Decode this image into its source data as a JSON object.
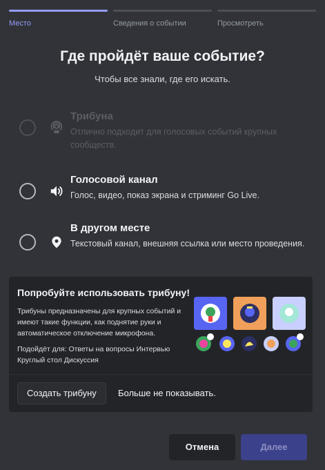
{
  "steps": [
    {
      "label": "Место",
      "active": true
    },
    {
      "label": "Сведения о событии",
      "active": false
    },
    {
      "label": "Просмотреть",
      "active": false
    }
  ],
  "title": "Где пройдёт ваше событие?",
  "subtitle": "Чтобы все знали, где его искать.",
  "options": [
    {
      "name": "Трибуна",
      "desc": "Отлично подходит для голосовых событий крупных сообществ.",
      "icon": "stage-icon",
      "disabled": true
    },
    {
      "name": "Голосовой канал",
      "desc": "Голос, видео, показ экрана и стриминг Go Live.",
      "icon": "speaker-icon",
      "disabled": false
    },
    {
      "name": "В другом месте",
      "desc": "Текстовый канал, внешняя ссылка или место проведения.",
      "icon": "location-pin-icon",
      "disabled": false
    }
  ],
  "promo": {
    "title": "Попробуйте использовать трибуну!",
    "desc": "Трибуны предназначены для крупных событий и имеют такие функции, как поднятие руки и автоматическое отключение микрофона.",
    "fit": "Подойдёт для:  Ответы на вопросы Интервью Круглый стол Дискуссия",
    "create_button": "Создать трибуну",
    "hide_link": "Больше не показывать."
  },
  "footer": {
    "cancel": "Отмена",
    "next": "Далее"
  },
  "colors": {
    "accent": "#949cf7",
    "background": "#313338",
    "promo_bg": "#232428"
  }
}
